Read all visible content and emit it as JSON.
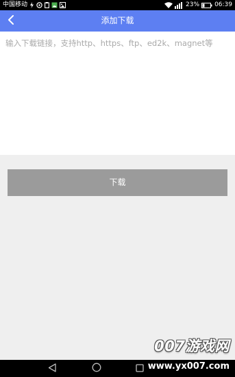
{
  "status_bar": {
    "carrier": "中国移动",
    "battery_percent": "23%",
    "time": "06:39"
  },
  "app_bar": {
    "title": "添加下载"
  },
  "download_form": {
    "link_placeholder": "输入下载链接，支持http、https、ftp、ed2k、magnet等",
    "link_value": "",
    "download_label": "下载"
  },
  "watermark": {
    "brand": "007游戏网",
    "url": "www.yx007.com"
  },
  "icons": {
    "back": "back-arrow-icon",
    "nav_back": "nav-back-icon",
    "nav_home": "nav-home-icon",
    "nav_recent": "nav-recent-apps-icon"
  },
  "colors": {
    "app_bar": "#5d7ff2",
    "button": "#9b9b9b",
    "background": "#efefef"
  }
}
